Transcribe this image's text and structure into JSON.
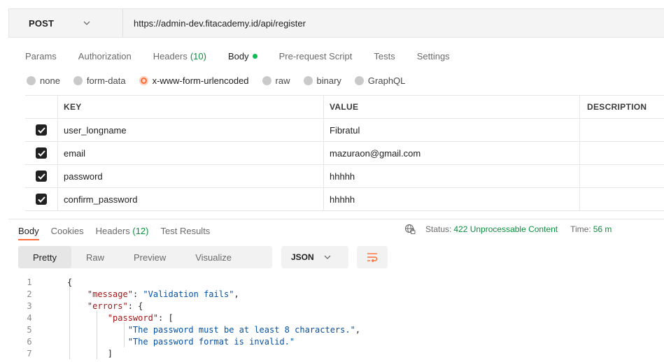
{
  "request": {
    "method": "POST",
    "url": "https://admin-dev.fitacademy.id/api/register"
  },
  "request_tabs": [
    {
      "label": "Params"
    },
    {
      "label": "Authorization"
    },
    {
      "label": "Headers",
      "count": "(10)"
    },
    {
      "label": "Body",
      "active": true
    },
    {
      "label": "Pre-request Script"
    },
    {
      "label": "Tests"
    },
    {
      "label": "Settings"
    }
  ],
  "body_types": [
    "none",
    "form-data",
    "x-www-form-urlencoded",
    "raw",
    "binary",
    "GraphQL"
  ],
  "body_type_selected": "x-www-form-urlencoded",
  "params_table": {
    "headers": {
      "key": "KEY",
      "value": "VALUE",
      "description": "DESCRIPTION"
    },
    "rows": [
      {
        "checked": true,
        "key": "user_longname",
        "value": "Fibratul",
        "description": ""
      },
      {
        "checked": true,
        "key": "email",
        "value": "mazuraon@gmail.com",
        "description": ""
      },
      {
        "checked": true,
        "key": "password",
        "value": "hhhhh",
        "description": ""
      },
      {
        "checked": true,
        "key": "confirm_password",
        "value": "hhhhh",
        "description": ""
      }
    ]
  },
  "response_tabs": [
    {
      "label": "Body",
      "active": true
    },
    {
      "label": "Cookies"
    },
    {
      "label": "Headers",
      "count": "(12)"
    },
    {
      "label": "Test Results"
    }
  ],
  "response_status": {
    "status_label": "Status:",
    "status_value": "422 Unprocessable Content",
    "time_label": "Time:",
    "time_value": "56 m"
  },
  "view_modes": [
    "Pretty",
    "Raw",
    "Preview",
    "Visualize"
  ],
  "view_mode_selected": "Pretty",
  "format": "JSON",
  "code_lines": [
    {
      "n": "1",
      "text": "{"
    },
    {
      "n": "2",
      "text": "    \"message\": \"Validation fails\","
    },
    {
      "n": "3",
      "text": "    \"errors\": {"
    },
    {
      "n": "4",
      "text": "        \"password\": ["
    },
    {
      "n": "5",
      "text": "            \"The password must be at least 8 characters.\","
    },
    {
      "n": "6",
      "text": "            \"The password format is invalid.\""
    },
    {
      "n": "7",
      "text": "        ]"
    }
  ],
  "colors": {
    "accent": "#ff6c37",
    "success": "#0a8f3c",
    "json_key": "#a31515",
    "json_string": "#0451a5"
  }
}
